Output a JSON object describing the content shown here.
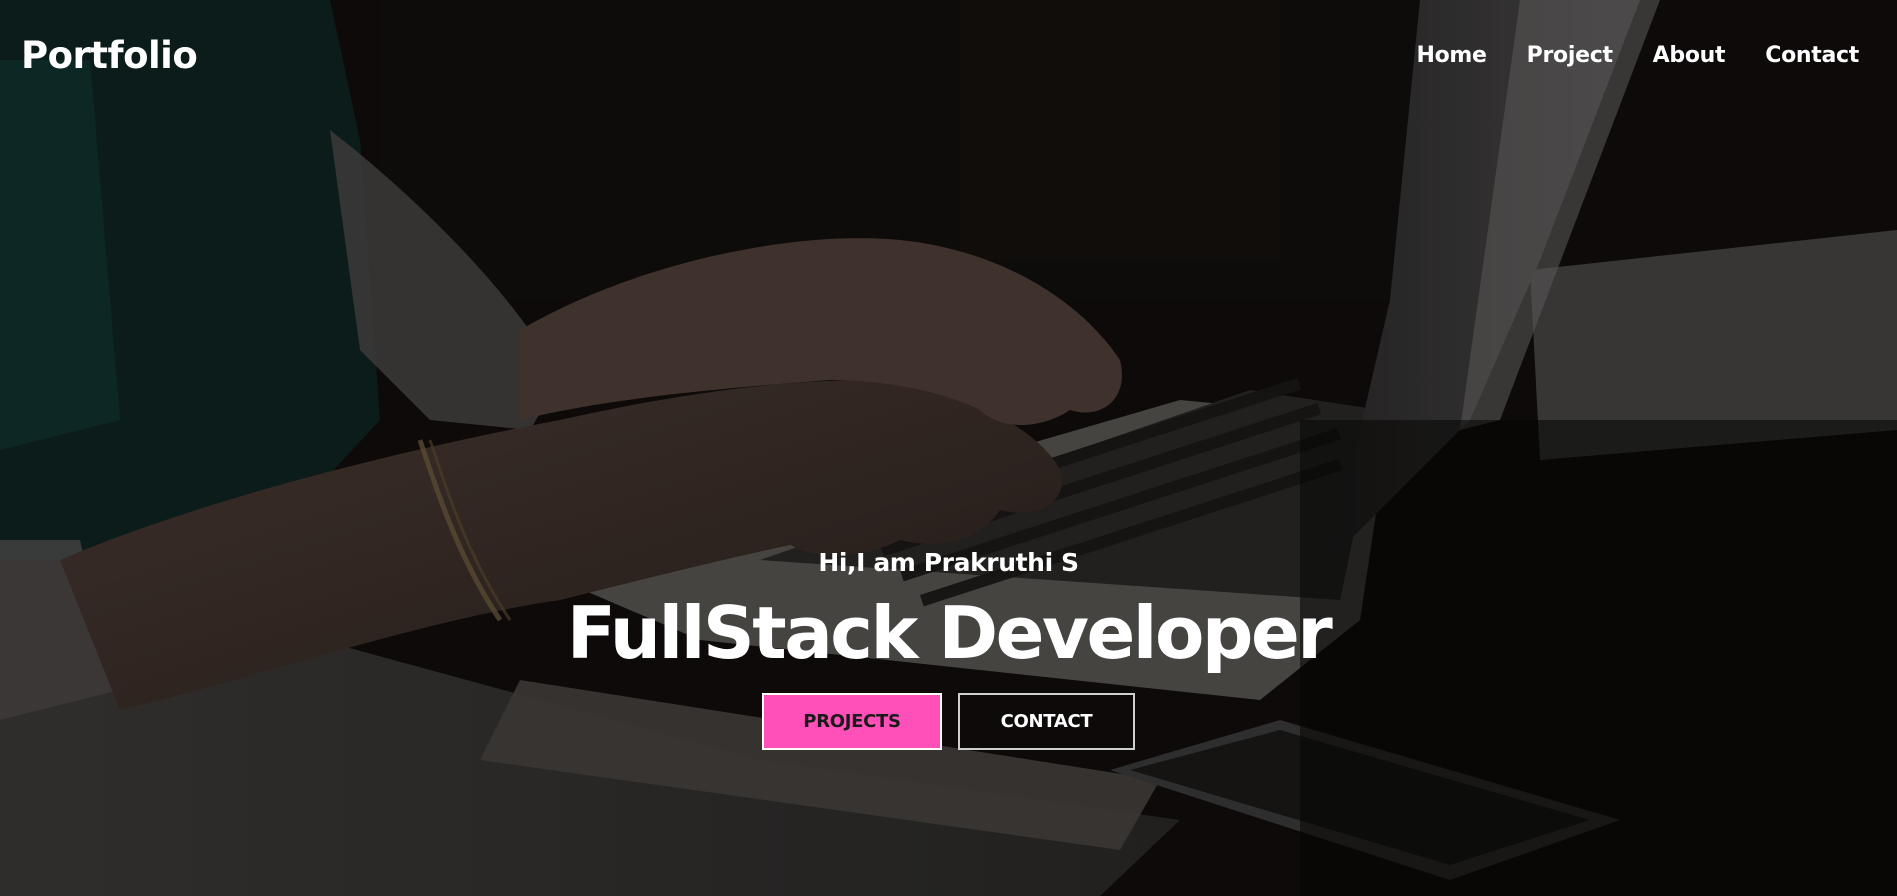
{
  "brand": {
    "logo": "Portfolio"
  },
  "nav": {
    "items": [
      {
        "label": "Home"
      },
      {
        "label": "Project"
      },
      {
        "label": "About"
      },
      {
        "label": "Contact"
      }
    ]
  },
  "hero": {
    "greeting": "Hi,I am Prakruthi S",
    "headline": "FullStack Developer",
    "primary_button": "PROJECTS",
    "secondary_button": "CONTACT",
    "background_image": "hands-typing-on-laptop"
  },
  "colors": {
    "accent": "#ff4fb8",
    "text": "#ffffff",
    "background": "#0b0a09"
  }
}
